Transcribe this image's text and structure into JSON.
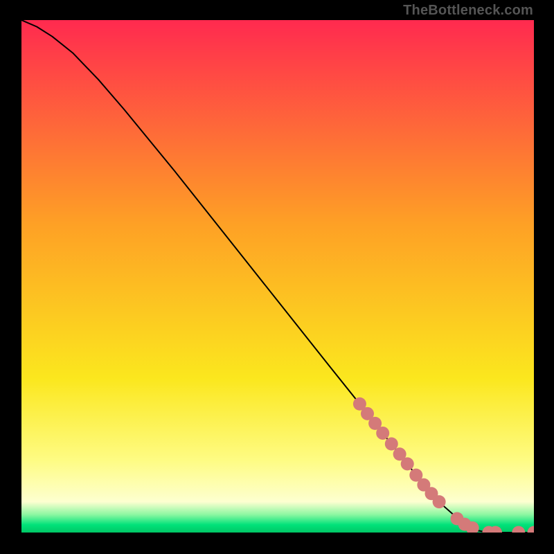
{
  "watermark": "TheBottleneck.com",
  "chart_data": {
    "type": "line",
    "title": "",
    "xlabel": "",
    "ylabel": "",
    "xlim": [
      0,
      100
    ],
    "ylim": [
      0,
      100
    ],
    "grid": false,
    "curve": {
      "x": [
        0,
        3,
        6,
        10,
        15,
        20,
        30,
        40,
        50,
        60,
        66,
        70,
        74,
        78,
        82,
        86,
        88,
        89.2,
        90.5,
        92,
        94,
        96,
        98,
        100
      ],
      "y": [
        100,
        98.7,
        96.8,
        93.6,
        88.4,
        82.6,
        70.4,
        57.8,
        45.2,
        32.6,
        25.1,
        20.0,
        15.0,
        10.0,
        5.5,
        2.0,
        0.9,
        0.35,
        0.1,
        0.0,
        0.0,
        0.0,
        0.0,
        0.0
      ]
    },
    "markers": {
      "color": "#d47a79",
      "radius_px": 9.5,
      "x": [
        66,
        67.5,
        69,
        70.5,
        72.2,
        73.8,
        75.3,
        77,
        78.5,
        80,
        81.5,
        85,
        86.5,
        88,
        91.2,
        92.5,
        97,
        100
      ],
      "y": [
        25.1,
        23.2,
        21.3,
        19.4,
        17.3,
        15.3,
        13.4,
        11.2,
        9.3,
        7.6,
        6.0,
        2.7,
        1.6,
        0.9,
        0.0,
        0.0,
        0.0,
        0.0
      ]
    },
    "background_gradient_stops": [
      {
        "offset": 0.0,
        "color": "#ff2a4f"
      },
      {
        "offset": 0.4,
        "color": "#fea125"
      },
      {
        "offset": 0.7,
        "color": "#fbe71e"
      },
      {
        "offset": 0.86,
        "color": "#fefc84"
      },
      {
        "offset": 0.94,
        "color": "#fdffd0"
      },
      {
        "offset": 0.965,
        "color": "#8cf7a1"
      },
      {
        "offset": 0.985,
        "color": "#00e27a"
      },
      {
        "offset": 1.0,
        "color": "#00c765"
      }
    ]
  }
}
